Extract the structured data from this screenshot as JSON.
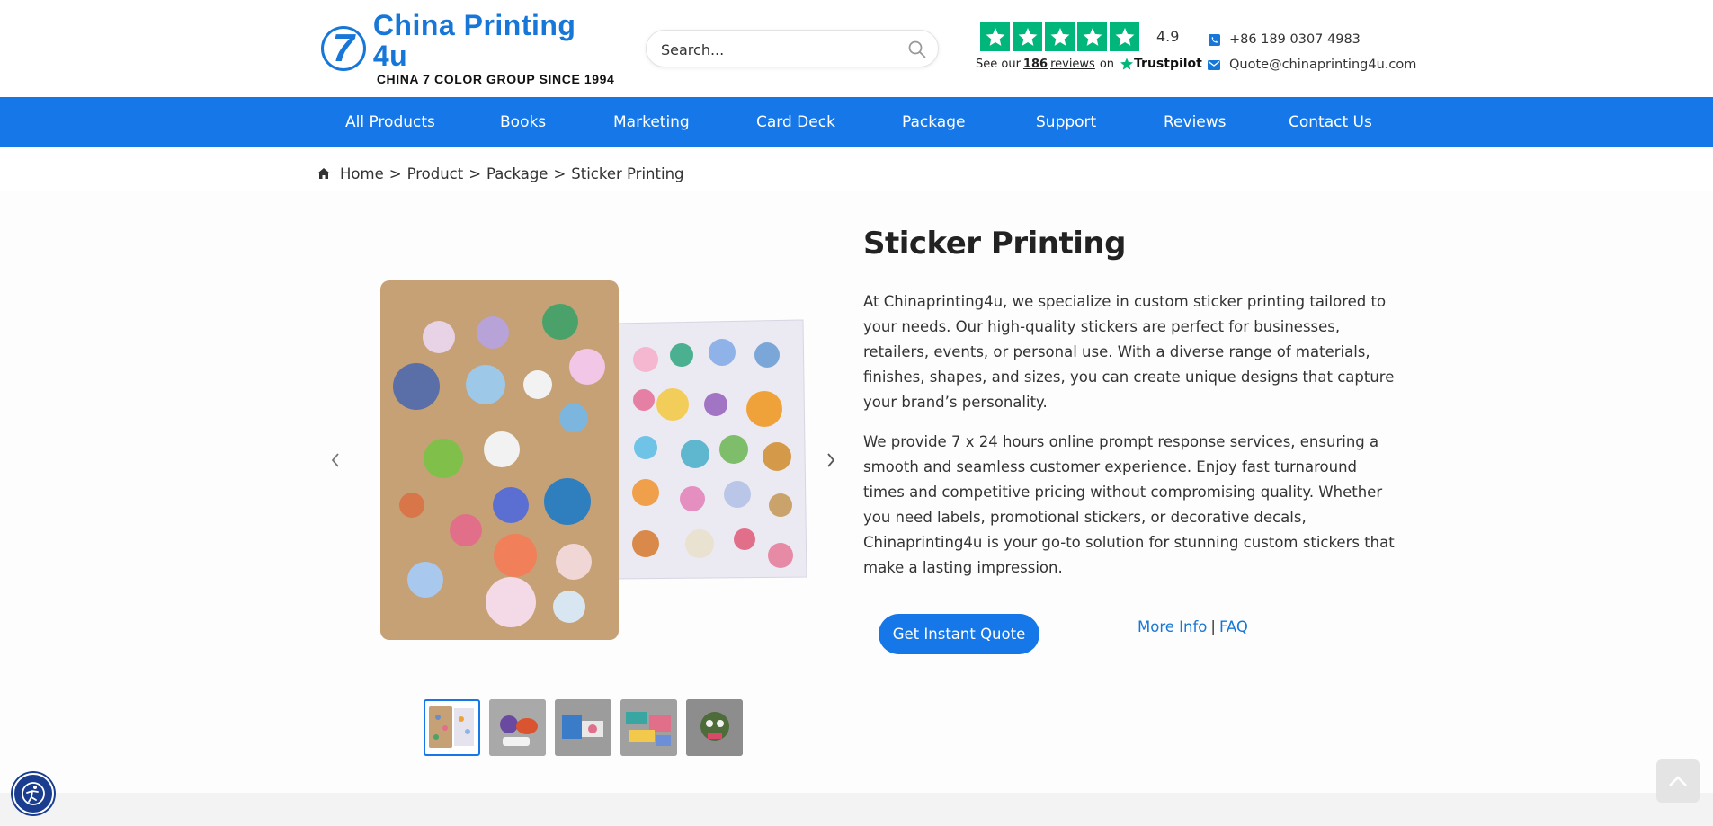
{
  "header": {
    "logo": {
      "mark": "7",
      "title": "China Printing 4u",
      "tagline": "CHINA 7 COLOR GROUP SINCE 1994"
    },
    "search": {
      "placeholder": "Search..."
    },
    "trustpilot": {
      "score": "4.9",
      "prefix": "See our",
      "count": "186",
      "reviews_word": "reviews",
      "on": "on",
      "brand": "Trustpilot",
      "color": "#00b67a"
    },
    "contact": {
      "phone": "+86 189 0307 4983",
      "email": "Quote@chinaprinting4u.com"
    }
  },
  "nav": {
    "items": [
      {
        "label": "All Products"
      },
      {
        "label": "Books"
      },
      {
        "label": "Marketing"
      },
      {
        "label": "Card Deck"
      },
      {
        "label": "Package"
      },
      {
        "label": "Support"
      },
      {
        "label": "Reviews"
      },
      {
        "label": "Contact Us"
      }
    ],
    "bg_color": "#1677e8"
  },
  "breadcrumb": {
    "home": "Home",
    "product": "Product",
    "package": "Package",
    "current": "Sticker Printing",
    "separator": ">"
  },
  "product": {
    "title": "Sticker Printing",
    "paragraphs": [
      "At Chinaprinting4u, we specialize in custom sticker printing tailored to your needs. Our high-quality stickers are perfect for businesses, retailers, events, or personal use. With a diverse range of materials, finishes, shapes, and sizes, you can create unique designs that capture your brand’s personality.",
      "We provide 7 x 24 hours online prompt response services, ensuring a smooth and seamless customer experience. Enjoy fast turnaround times and competitive pricing without compromising quality. Whether you need labels, promotional stickers, or decorative decals, Chinaprinting4u is your go-to solution for stunning custom stickers that make a lasting impression."
    ],
    "quote_button": "Get Instant Quote",
    "more_info": "More Info",
    "link_separator": "|",
    "faq": "FAQ"
  },
  "gallery": {
    "thumbnail_count": 5,
    "active_index": 0
  }
}
